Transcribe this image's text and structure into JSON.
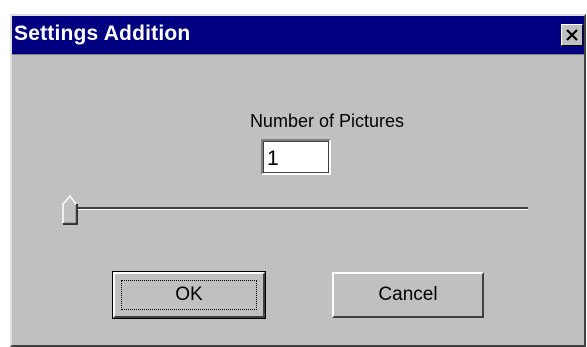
{
  "window": {
    "title": "Settings Addition",
    "close_icon": "close-icon"
  },
  "settings": {
    "label": "Number of Pictures",
    "value": "1"
  },
  "slider": {
    "value_fraction": 0.0,
    "thumb_icon": "slider-thumb"
  },
  "buttons": {
    "ok_label": "OK",
    "cancel_label": "Cancel"
  },
  "colors": {
    "titlebar": "#000080",
    "face": "#c0c0c0",
    "title_text": "#ffffff"
  }
}
